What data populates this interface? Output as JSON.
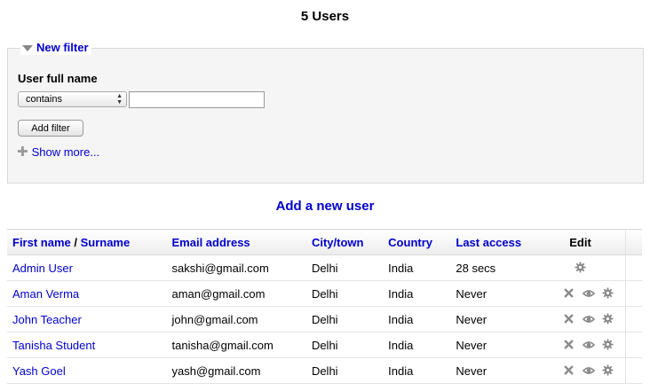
{
  "page": {
    "title": "5 Users"
  },
  "filter": {
    "legend": "New filter",
    "field_label": "User full name",
    "operator_selected": "contains",
    "value": "",
    "add_button": "Add filter",
    "show_more": "Show more..."
  },
  "add_user_link": "Add a new user",
  "table": {
    "headers": {
      "first_name": "First name",
      "separator": " / ",
      "surname": "Surname",
      "email": "Email address",
      "city": "City/town",
      "country": "Country",
      "last_access": "Last access",
      "edit": "Edit"
    },
    "rows": [
      {
        "name": "Admin User",
        "email": "sakshi@gmail.com",
        "city": "Delhi",
        "country": "India",
        "last_access": "28 secs",
        "actions": [
          "settings-icon"
        ]
      },
      {
        "name": "Aman Verma",
        "email": "aman@gmail.com",
        "city": "Delhi",
        "country": "India",
        "last_access": "Never",
        "actions": [
          "delete-icon",
          "view-icon",
          "settings-icon"
        ]
      },
      {
        "name": "John Teacher",
        "email": "john@gmail.com",
        "city": "Delhi",
        "country": "India",
        "last_access": "Never",
        "actions": [
          "delete-icon",
          "view-icon",
          "settings-icon"
        ]
      },
      {
        "name": "Tanisha Student",
        "email": "tanisha@gmail.com",
        "city": "Delhi",
        "country": "India",
        "last_access": "Never",
        "actions": [
          "delete-icon",
          "view-icon",
          "settings-icon"
        ]
      },
      {
        "name": "Yash Goel",
        "email": "yash@gmail.com",
        "city": "Delhi",
        "country": "India",
        "last_access": "Never",
        "actions": [
          "delete-icon",
          "view-icon",
          "settings-icon"
        ]
      }
    ]
  },
  "colors": {
    "link": "#0000cc",
    "icon": "#8a8a8a",
    "panel_bg": "#f5f5f5"
  }
}
